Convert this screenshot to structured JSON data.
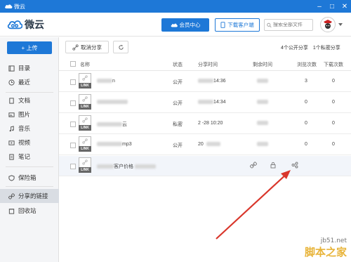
{
  "window": {
    "title": "微云"
  },
  "header": {
    "brand": "微云",
    "vip_label": "会员中心",
    "download_label": "下载客户端",
    "search_placeholder": "搜索全部文件"
  },
  "sidebar": {
    "upload_label": "+ 上传",
    "items": [
      {
        "label": "目录",
        "icon": "catalog-icon"
      },
      {
        "label": "最近",
        "icon": "clock-icon"
      },
      {
        "label": "文档",
        "icon": "document-icon"
      },
      {
        "label": "图片",
        "icon": "image-icon"
      },
      {
        "label": "音乐",
        "icon": "music-icon"
      },
      {
        "label": "视频",
        "icon": "video-icon"
      },
      {
        "label": "笔记",
        "icon": "note-icon"
      },
      {
        "label": "保险箱",
        "icon": "shield-icon"
      },
      {
        "label": "分享的链接",
        "icon": "link-icon",
        "active": true
      },
      {
        "label": "回收站",
        "icon": "trash-icon"
      }
    ]
  },
  "toolbar": {
    "cancel_share_label": "取消分享",
    "share_count_text": "4个公开分享　1个私密分享"
  },
  "table": {
    "columns": {
      "name": "名称",
      "status": "状态",
      "share_time": "分享时间",
      "remaining": "剩余时间",
      "views": "浏览次数",
      "downloads": "下载次数"
    },
    "link_tag": "LINK",
    "rows": [
      {
        "name_suffix": "n",
        "status": "公开",
        "time_suffix": "14:36",
        "views": "3",
        "downloads": "0"
      },
      {
        "name_suffix": "",
        "status": "公开",
        "time_suffix": "14:34",
        "views": "0",
        "downloads": "0"
      },
      {
        "name_suffix": "云",
        "status": "私密",
        "time_suffix": "2 -28 10:20",
        "views": "0",
        "downloads": "0"
      },
      {
        "name_suffix": "mp3",
        "status": "公开",
        "time_suffix": "20",
        "views": "0",
        "downloads": "0"
      },
      {
        "name_suffix": "客户价格",
        "status": "",
        "time_suffix": "",
        "views": "",
        "downloads": ""
      }
    ]
  },
  "watermark": {
    "site": "jb51.net",
    "name": "脚本之家"
  },
  "colors": {
    "brand_blue": "#1e78d7",
    "arrow_red": "#d9362b"
  }
}
